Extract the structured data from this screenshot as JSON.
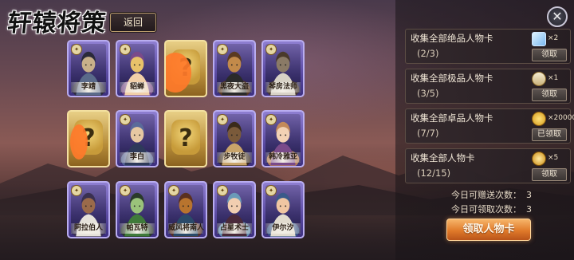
{
  "header": {
    "title": "轩辕将策",
    "back_label": "返回"
  },
  "cards": [
    {
      "name": "李靖",
      "frame": "purple",
      "badge": "",
      "art": "warrior"
    },
    {
      "name": "貂蝉",
      "frame": "purple",
      "badge": "",
      "art": "lady"
    },
    {
      "name": "",
      "frame": "unknown",
      "badge": "",
      "art": "unknown",
      "redacted": true
    },
    {
      "name": "黑夜大盗",
      "frame": "purple",
      "badge": "",
      "art": "masked"
    },
    {
      "name": "琴房法师",
      "frame": "purple",
      "badge": "",
      "art": "elder"
    },
    {
      "name": "",
      "frame": "unknown",
      "badge": "",
      "art": "unknown",
      "redacted": true
    },
    {
      "name": "李白",
      "frame": "purple",
      "badge": "",
      "art": "scholar"
    },
    {
      "name": "",
      "frame": "unknown",
      "badge": "",
      "art": "unknown"
    },
    {
      "name": "步牧徒",
      "frame": "purple",
      "badge": "",
      "art": "hooded"
    },
    {
      "name": "韩冷雅亚",
      "frame": "purple",
      "badge": "",
      "art": "lady2"
    },
    {
      "name": "阿拉伯人",
      "frame": "purple",
      "badge": "",
      "art": "turban"
    },
    {
      "name": "帕瓦特",
      "frame": "purple",
      "badge": "",
      "art": "monster"
    },
    {
      "name": "威风将南人",
      "frame": "purple",
      "badge": "",
      "art": "general"
    },
    {
      "name": "占星术士",
      "frame": "purple",
      "badge": "",
      "art": "dancer"
    },
    {
      "name": "伊尔汐",
      "frame": "purple",
      "badge": "",
      "art": "girl"
    }
  ],
  "rewards": [
    {
      "title": "收集全部绝品人物卡",
      "progress": "(2/3)",
      "count": "×2",
      "icon": "crystal-icon",
      "button": "领取",
      "state": "available"
    },
    {
      "title": "收集全部极品人物卡",
      "progress": "(3/5)",
      "count": "×1",
      "icon": "scroll-icon",
      "button": "领取",
      "state": "available"
    },
    {
      "title": "收集全部卓品人物卡",
      "progress": "(7/7)",
      "count": "×20000",
      "icon": "gold-coins-icon",
      "button": "已领取",
      "state": "claimed"
    },
    {
      "title": "收集全部人物卡",
      "progress": "(12/15)",
      "count": "×5",
      "icon": "gold-medal-icon",
      "button": "领取",
      "state": "available"
    }
  ],
  "daily": {
    "give_label": "今日可赠送次数：",
    "give_count": "3",
    "receive_label": "今日可领取次数：",
    "receive_count": "3"
  },
  "claim_button": "领取人物卡",
  "close_icon": "close-icon"
}
